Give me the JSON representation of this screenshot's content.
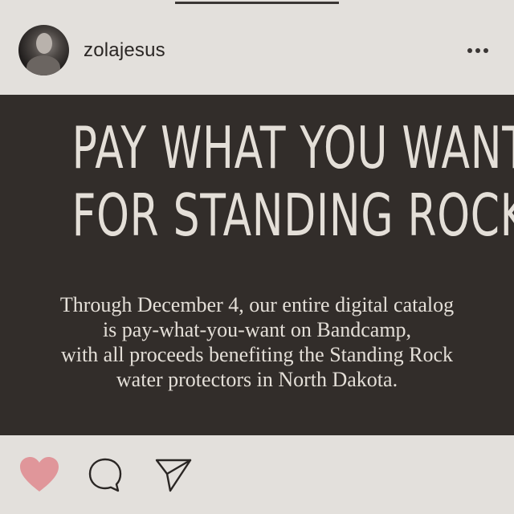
{
  "header": {
    "username": "zolajesus"
  },
  "post": {
    "headline_lines": [
      "PAY WHAT YOU WANT",
      "FOR STANDING ROCK"
    ],
    "body_lines": [
      "Through December 4, our entire digital catalog",
      "is pay-what-you-want on Bandcamp,",
      "with all proceeds benefiting the Standing Rock",
      "water protectors in North Dakota."
    ]
  },
  "actions": {
    "like_icon": "heart-icon",
    "like_color": "#e0969a",
    "comment_icon": "comment-icon",
    "share_icon": "send-icon"
  },
  "colors": {
    "background": "#e3e0dc",
    "post_background": "#322d2a",
    "post_text": "#e4dfd8"
  }
}
